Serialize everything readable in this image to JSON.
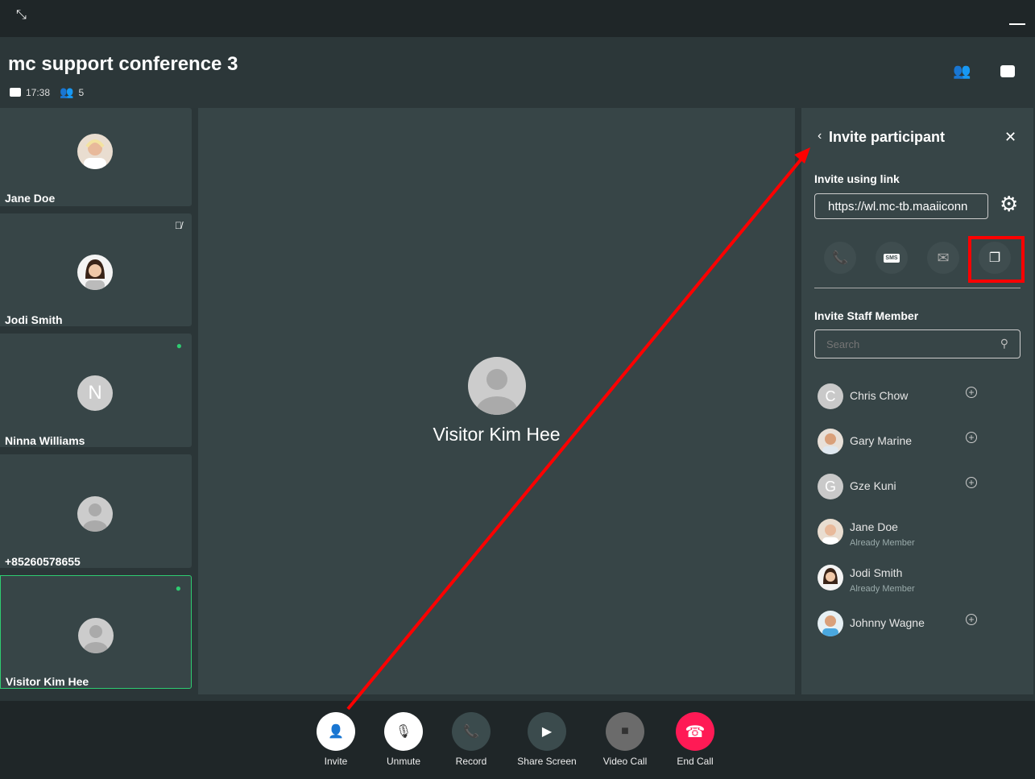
{
  "header": {
    "title": "mc support conference 3",
    "duration": "17:38",
    "participant_count": "5"
  },
  "participants": [
    {
      "name": "Jane Doe",
      "avatar": "photo",
      "muted": false
    },
    {
      "name": "Jodi Smith",
      "avatar": "photo",
      "muted": true
    },
    {
      "name": "Ninna Williams",
      "avatar": "N",
      "speaking": true
    },
    {
      "name": "+85260578655",
      "avatar": "default"
    },
    {
      "name": "Visitor Kim Hee",
      "avatar": "default",
      "speaking": true,
      "active": true
    }
  ],
  "main": {
    "name": "Visitor Kim Hee"
  },
  "panel": {
    "title": "Invite participant",
    "link_label": "Invite using link",
    "link_value": "https://wl.mc-tb.maaiiconn",
    "share_buttons": [
      "phone-icon",
      "sms-icon",
      "email-icon",
      "copy-icon"
    ],
    "sms_text": "SMS",
    "staff_label": "Invite Staff Member",
    "search_placeholder": "Search",
    "staff": [
      {
        "name": "Chris Chow",
        "initial": "C",
        "status": ""
      },
      {
        "name": "Gary Marine",
        "initial": "",
        "status": ""
      },
      {
        "name": "Gze Kuni",
        "initial": "G",
        "status": ""
      },
      {
        "name": "Jane Doe",
        "initial": "",
        "status": "Already Member"
      },
      {
        "name": "Jodi Smith",
        "initial": "",
        "status": "Already Member"
      },
      {
        "name": "Johnny Wagne",
        "initial": "",
        "status": ""
      }
    ]
  },
  "controls": [
    {
      "label": "Invite"
    },
    {
      "label": "Unmute"
    },
    {
      "label": "Record"
    },
    {
      "label": "Share Screen"
    },
    {
      "label": "Video Call"
    },
    {
      "label": "End Call"
    }
  ],
  "colors": {
    "end_call": "#ff1a55",
    "speaking": "#2ecc71",
    "annotation": "#ff0000"
  }
}
